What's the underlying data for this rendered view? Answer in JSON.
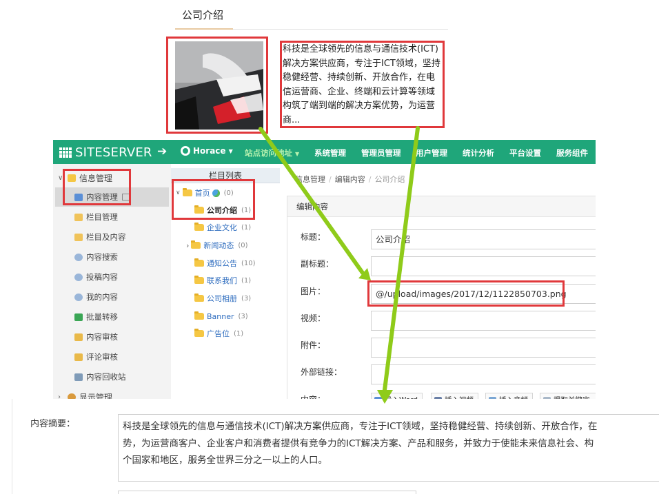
{
  "preview": {
    "title": "公司介绍",
    "summary_text": "科技是全球领先的信息与通信技术(ICT)解决方案供应商，专注于ICT领域，坚持稳健经营、持续创新、开放合作，在电信运营商、企业、终端和云计算等领域构筑了端到端的解决方案优势，为运营商..."
  },
  "header": {
    "logo": "SITESERVER",
    "back_icon": "arrow-left-icon",
    "user": "Horace",
    "nav": [
      "站点访问地址",
      "系统管理",
      "管理员管理",
      "用户管理",
      "统计分析",
      "平台设置",
      "服务组件"
    ]
  },
  "sidebar": {
    "group": "信息管理",
    "items": [
      {
        "label": "内容管理",
        "icon": "content-icon"
      },
      {
        "label": "栏目管理",
        "icon": "folder-icon"
      },
      {
        "label": "栏目及内容",
        "icon": "folder-icon"
      },
      {
        "label": "内容搜索",
        "icon": "search-icon"
      },
      {
        "label": "投稿内容",
        "icon": "search-icon"
      },
      {
        "label": "我的内容",
        "icon": "search-icon"
      },
      {
        "label": "批量转移",
        "icon": "transfer-icon"
      },
      {
        "label": "内容审核",
        "icon": "shield-icon"
      },
      {
        "label": "评论审核",
        "icon": "shield-icon"
      },
      {
        "label": "内容回收站",
        "icon": "recycle-icon"
      }
    ],
    "group2": "显示管理"
  },
  "tree": {
    "header": "栏目列表",
    "root": {
      "label": "首页",
      "count": "(0)"
    },
    "items": [
      {
        "label": "公司介绍",
        "count": "(1)"
      },
      {
        "label": "企业文化",
        "count": "(1)"
      },
      {
        "label": "新闻动态",
        "count": "(0)"
      },
      {
        "label": "通知公告",
        "count": "(10)"
      },
      {
        "label": "联系我们",
        "count": "(1)"
      },
      {
        "label": "公司相册",
        "count": "(3)"
      },
      {
        "label": "Banner",
        "count": "(3)"
      },
      {
        "label": "广告位",
        "count": "(1)"
      }
    ]
  },
  "breadcrumb": [
    "信息管理",
    "编辑内容",
    "公司介绍"
  ],
  "panel": {
    "title": "编辑内容",
    "fields": [
      {
        "label": "标题：",
        "value": "公司介绍"
      },
      {
        "label": "副标题：",
        "value": ""
      },
      {
        "label": "图片：",
        "value": "@/upload/images/2017/12/1122850703.png"
      },
      {
        "label": "视频：",
        "value": ""
      },
      {
        "label": "附件：",
        "value": ""
      },
      {
        "label": "外部链接：",
        "value": ""
      },
      {
        "label": "内容：",
        "value": ""
      }
    ],
    "tools": [
      "导入Word",
      "插入视频",
      "插入音频",
      "提取关键字"
    ]
  },
  "summary": {
    "label": "内容摘要：",
    "lines": [
      "科技是全球领先的信息与通信技术(ICT)解决方案供应商，专注于ICT领域，坚持稳健经营、持续创新、开放合作，在",
      "势，为运营商客户、企业客户和消费者提供有竞争力的ICT解决方案、产品和服务，并致力于使能未来信息社会、构",
      "个国家和地区，服务全世界三分之一以上的人口。"
    ]
  },
  "colors": {
    "brand": "#1fa67a",
    "highlight": "#e0383b",
    "arrow": "#8fcb1a"
  }
}
